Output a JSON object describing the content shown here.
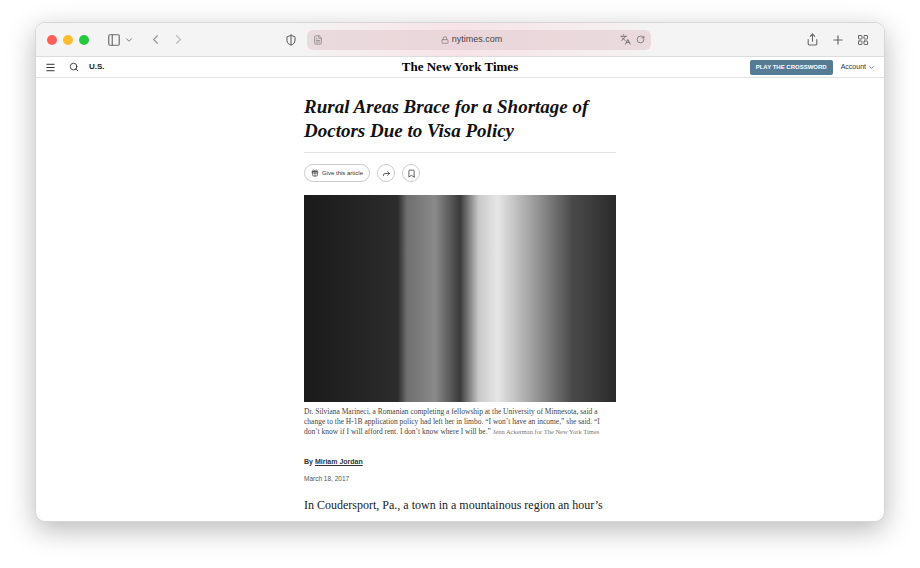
{
  "browser": {
    "url": "nytimes.com"
  },
  "nav": {
    "section": "U.S.",
    "logo": "The New York Times",
    "crossword_button": "PLAY THE CROSSWORD",
    "account": "Account"
  },
  "article": {
    "headline": "Rural Areas Brace for a Shortage of Doctors Due to Visa Policy",
    "gift_button": "Give this article",
    "caption": "Dr. Silviana Marineci, a Romanian completing a fellowship at the University of Minnesota, said a change to the H-1B application policy had left her in limbo. “I won’t have an income,” she said. “I don’t know if I will afford rent. I don’t know where I will be.”",
    "credit": "Jenn Ackerman for The New York Times",
    "byline_prefix": "By",
    "author": "Miriam Jordan",
    "date": "March 18, 2017",
    "body": "In Coudersport, Pa., a town in a mountainous region an hour’s"
  }
}
